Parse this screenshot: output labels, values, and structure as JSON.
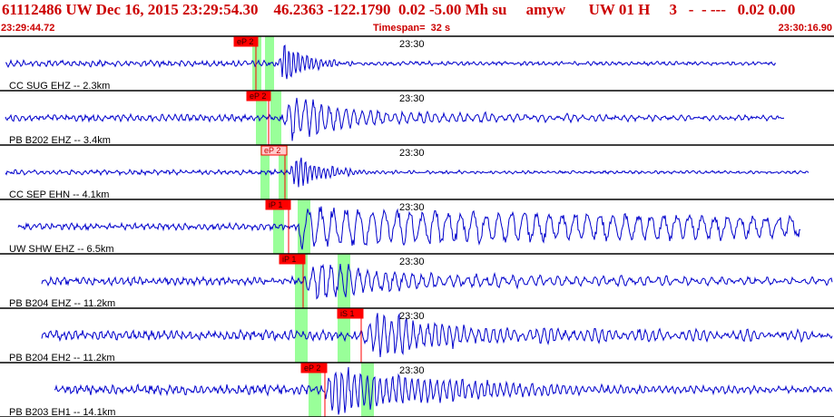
{
  "header": {
    "title": "61112486 UW Dec 16, 2015 23:29:54.30    46.2363 -122.1790  0.02 -5.00 Mh su     amyw      UW 01 H     3   -  - ---   0.02 0.00",
    "start_time": "23:29:44.72",
    "timespan": "Timespan=  32 s",
    "end_time": "23:30:16.90"
  },
  "colors": {
    "header_text": "#cc0000",
    "trace": "#0000cc",
    "pick_box": "#ff0000",
    "pick_box_light": "#ffcccc",
    "pick_window": "#99ff99"
  },
  "channels": [
    {
      "label": "CC SUG EHZ -- 2.3km",
      "time_label": "23:30",
      "phases": [
        {
          "label": "eP 2",
          "style": "solid"
        }
      ],
      "signal_start": 0.31,
      "signal_end": 0.93,
      "noise_end": 0.93
    },
    {
      "label": "PB B202 EHZ -- 3.4km",
      "time_label": "23:30",
      "phases": [
        {
          "label": "eP 2",
          "style": "solid"
        }
      ],
      "signal_start": 0.33,
      "signal_end": 0.94,
      "noise_end": 0.94
    },
    {
      "label": "CC SEP EHN -- 4.1km",
      "time_label": "23:30",
      "phases": [
        {
          "label": "eP 2",
          "style": "light"
        }
      ],
      "signal_start": 0.34,
      "signal_end": 0.97,
      "noise_end": 0.97
    },
    {
      "label": "UW SHW EHZ -- 6.5km",
      "time_label": "23:30",
      "phases": [
        {
          "label": "iP 1",
          "style": "solid"
        }
      ],
      "signal_start": 0.35,
      "signal_end": 0.96,
      "noise_end": 0.96
    },
    {
      "label": "PB B204 EHZ -- 11.2km",
      "time_label": "23:30",
      "phases": [
        {
          "label": "iP 1",
          "style": "solid"
        }
      ],
      "signal_start": 0.37,
      "signal_end": 1.0,
      "noise_end": 1.0
    },
    {
      "label": "PB B204 EH2 -- 11.2km",
      "time_label": "23:30",
      "phases": [
        {
          "label": "iS 1",
          "style": "solid"
        }
      ],
      "signal_start": 0.41,
      "signal_end": 1.0,
      "noise_end": 1.0
    },
    {
      "label": "PB B203 EH1 -- 14.1km",
      "time_label": "23:30",
      "phases": [
        {
          "label": "eP 2",
          "style": "solid"
        }
      ],
      "signal_start": 0.37,
      "signal_end": 1.0,
      "noise_end": 1.0
    }
  ]
}
